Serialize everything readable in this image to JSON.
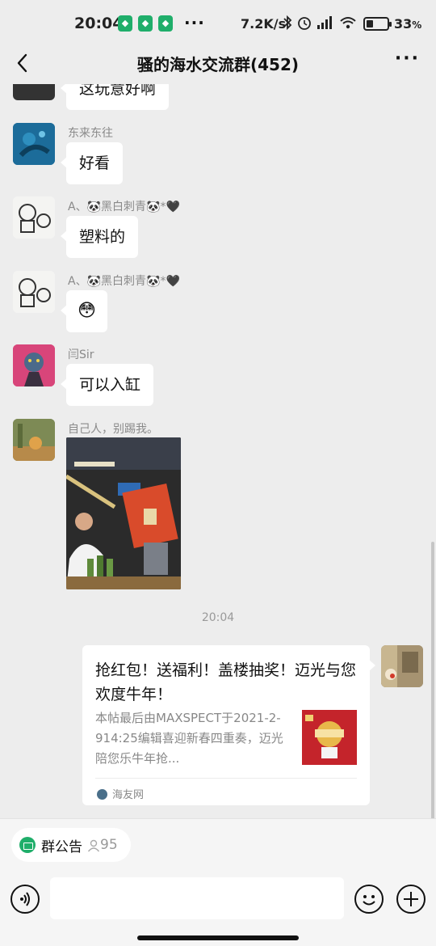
{
  "status_bar": {
    "time": "20:04",
    "more": "···",
    "net_speed": "7.2K/s",
    "battery": "33",
    "battery_unit": "%",
    "battery_level": 0.33
  },
  "nav": {
    "title": "骚的海水交流群(452)",
    "more": "···"
  },
  "messages": [
    {
      "text": "这玩意好啊"
    },
    {
      "sender": "东来东往",
      "text": "好看"
    },
    {
      "sender": "A、🐼黑白刺青🐼*🖤",
      "text": "塑料的"
    },
    {
      "sender": "A、🐼黑白刺青🐼*🖤",
      "text": "😳"
    },
    {
      "sender": "闫Sir",
      "text": "可以入缸"
    },
    {
      "sender": "自己人，别踢我。"
    }
  ],
  "timestamp": "20:04",
  "link_card": {
    "title": "抢红包！送福利！盖楼抽奖！迈光与您欢度牛年！",
    "description": "本帖最后由MAXSPECT于2021-2-914:25编辑喜迎新春四重奏，迈光陪您乐牛年抢...",
    "source": "海友网"
  },
  "notice": {
    "label": "群公告",
    "count": "95"
  },
  "colors": {
    "background": "#ededed",
    "bubble": "#ffffff",
    "accent": "#1fae6a"
  }
}
